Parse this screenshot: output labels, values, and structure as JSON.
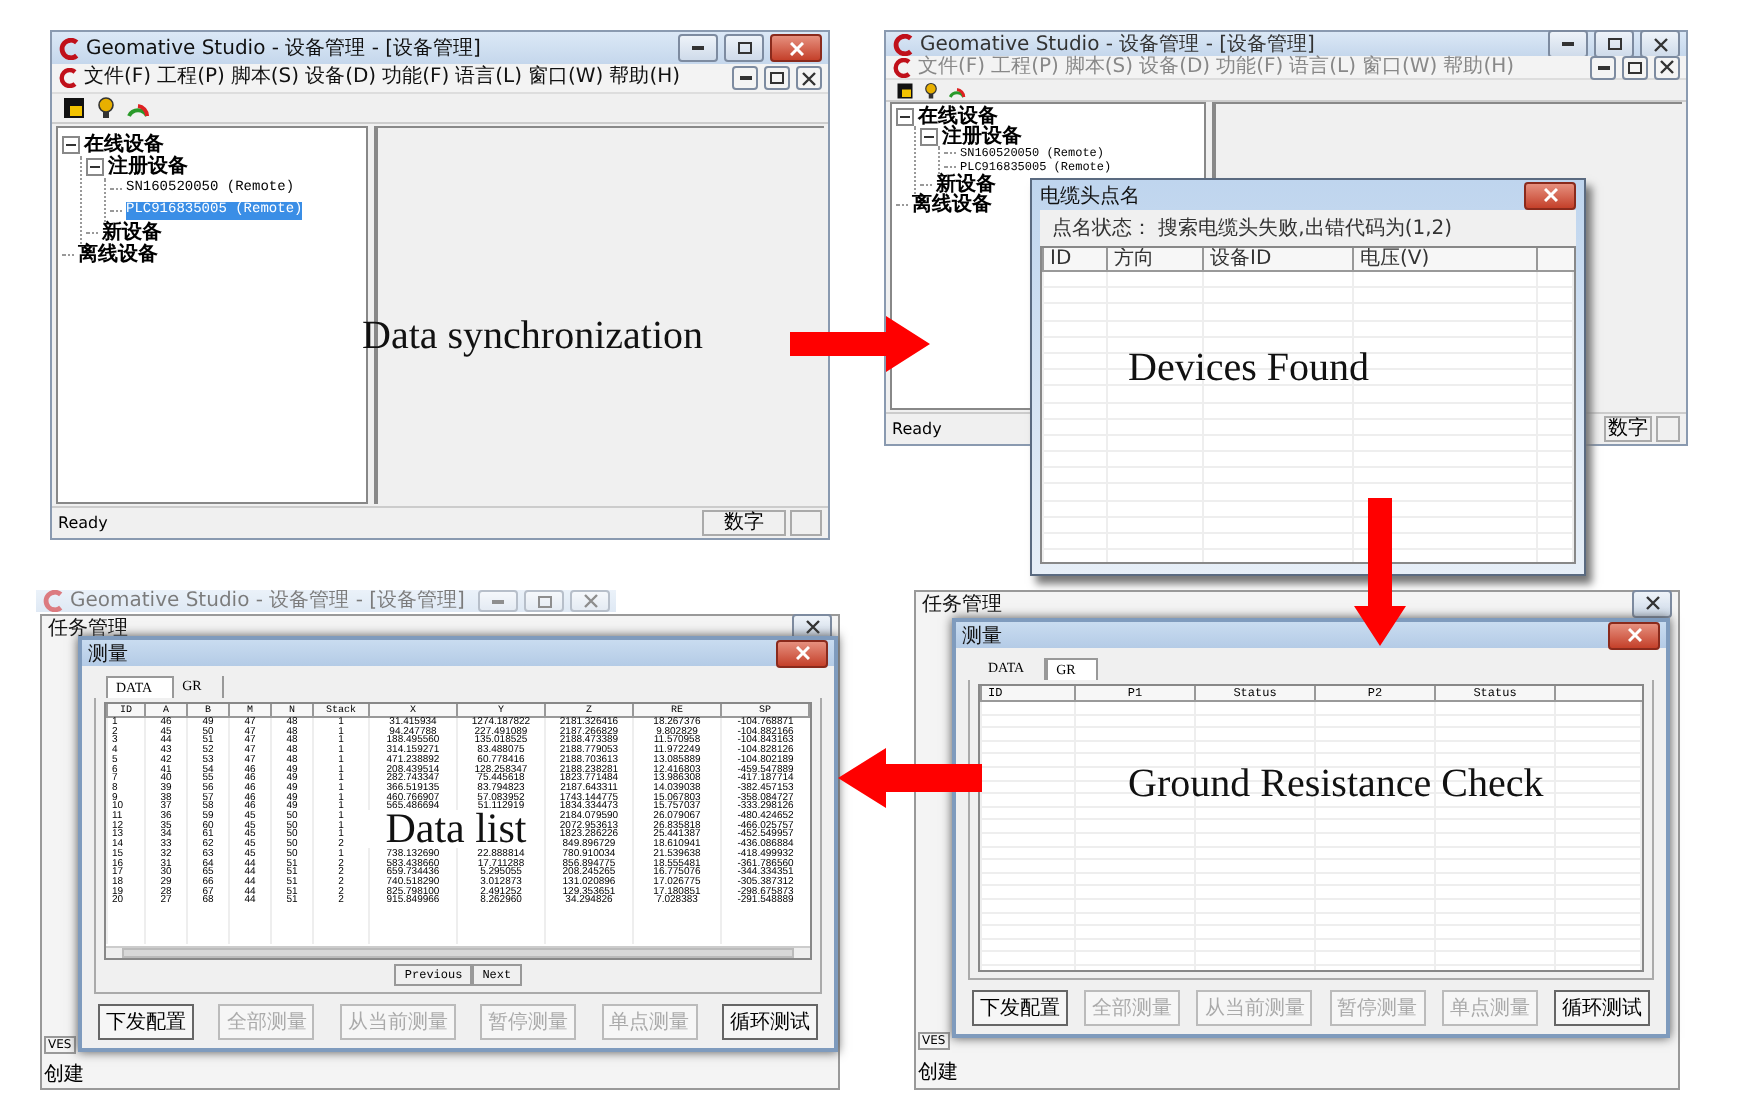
{
  "panels": [
    {
      "kind": "device_manager",
      "active": true,
      "window": {
        "title": "Geomative Studio - 设备管理 - [设备管理]"
      },
      "menu": [
        "文件(F)",
        "工程(P)",
        "脚本(S)",
        "设备(D)",
        "功能(F)",
        "语言(L)",
        "窗口(W)",
        "帮助(H)"
      ],
      "tree": [
        {
          "label": "在线设备",
          "expanded": true,
          "selected": false,
          "children": [
            {
              "label": "注册设备",
              "expanded": true,
              "selected": false,
              "children": [
                {
                  "label": "SN160520050 (Remote)",
                  "selected": false
                },
                {
                  "label": "PLC916835005 (Remote)",
                  "selected": true
                }
              ]
            },
            {
              "label": "新设备",
              "selected": false
            }
          ]
        },
        {
          "label": "离线设备",
          "selected": false
        }
      ],
      "status_bar": {
        "text": "Ready",
        "indicator": "数字"
      },
      "caption": "Data synchronization"
    },
    {
      "kind": "device_manager",
      "active": false,
      "window": {
        "title": "Geomative Studio - 设备管理 - [设备管理]"
      },
      "menu": [
        "文件(F)",
        "工程(P)",
        "脚本(S)",
        "设备(D)",
        "功能(F)",
        "语言(L)",
        "窗口(W)",
        "帮助(H)"
      ],
      "tree": [
        {
          "label": "在线设备",
          "expanded": true,
          "selected": false,
          "children": [
            {
              "label": "注册设备",
              "expanded": true,
              "selected": false,
              "children": [
                {
                  "label": "SN160520050 (Remote)",
                  "selected": false
                },
                {
                  "label": "PLC916835005 (Remote)",
                  "selected": false
                }
              ]
            },
            {
              "label": "新设备",
              "selected": false
            }
          ]
        },
        {
          "label": "离线设备",
          "selected": false
        }
      ],
      "status_bar": {
        "text": "Ready",
        "indicator": "数字"
      },
      "dialog": {
        "title": "电缆头点名",
        "status": "点名状态：  搜索电缆头失败,出错代码为(1,2)",
        "columns": [
          "ID",
          "方向",
          "设备ID",
          "电压(V)"
        ]
      },
      "caption": "Devices Found"
    },
    {
      "kind": "measurement",
      "back_window": {
        "title": "Geomative Studio - 设备管理 - [设备管理]"
      },
      "task_window": {
        "title": "任务管理",
        "tab": "VES",
        "label": "创建"
      },
      "dialog": {
        "title": "测量",
        "tabs": [
          {
            "label": "DATA",
            "selected": true
          },
          {
            "label": "GR",
            "selected": false
          }
        ],
        "columns": [
          "ID",
          "A",
          "B",
          "M",
          "N",
          "Stack",
          "X",
          "Y",
          "Z",
          "RE",
          "SP"
        ],
        "rows": [
          [
            "1",
            "46",
            "49",
            "47",
            "48",
            "1",
            "31.415934",
            "1274.187822",
            "2181.326416",
            "18.267376",
            "-104.768871"
          ],
          [
            "2",
            "45",
            "50",
            "47",
            "48",
            "1",
            "94.247788",
            "227.491089",
            "2187.266829",
            "9.802829",
            "-104.882166"
          ],
          [
            "3",
            "44",
            "51",
            "47",
            "48",
            "1",
            "188.495560",
            "135.018525",
            "2188.473389",
            "11.570958",
            "-104.843163"
          ],
          [
            "4",
            "43",
            "52",
            "47",
            "48",
            "1",
            "314.159271",
            "83.488075",
            "2188.779053",
            "11.972249",
            "-104.828126"
          ],
          [
            "5",
            "42",
            "53",
            "47",
            "48",
            "1",
            "471.238892",
            "60.778416",
            "2188.703613",
            "13.085889",
            "-104.802189"
          ],
          [
            "6",
            "41",
            "54",
            "46",
            "49",
            "1",
            "208.439514",
            "128.258347",
            "2188.238281",
            "12.416803",
            "-459.547889"
          ],
          [
            "7",
            "40",
            "55",
            "46",
            "49",
            "1",
            "282.743347",
            "75.445618",
            "1823.771484",
            "13.986308",
            "-417.187714"
          ],
          [
            "8",
            "39",
            "56",
            "46",
            "49",
            "1",
            "366.519135",
            "83.794823",
            "2187.643311",
            "14.039038",
            "-382.457153"
          ],
          [
            "9",
            "38",
            "57",
            "46",
            "49",
            "1",
            "460.766907",
            "57.083952",
            "1743.144775",
            "15.067803",
            "-358.084727"
          ],
          [
            "10",
            "37",
            "58",
            "46",
            "49",
            "1",
            "565.486694",
            "51.112919",
            "1834.334473",
            "15.757037",
            "-333.298126"
          ],
          [
            "11",
            "36",
            "59",
            "45",
            "50",
            "1",
            null,
            null,
            "2184.079590",
            "26.079067",
            "-480.424652"
          ],
          [
            "12",
            "35",
            "60",
            "45",
            "50",
            "1",
            null,
            null,
            "2072.953613",
            "26.835818",
            "-466.025757"
          ],
          [
            "13",
            "34",
            "61",
            "45",
            "50",
            "1",
            null,
            null,
            "1823.286226",
            "25.441387",
            "-452.549957"
          ],
          [
            "14",
            "33",
            "62",
            "45",
            "50",
            "2",
            null,
            null,
            "849.896729",
            "18.610941",
            "-436.086884"
          ],
          [
            "15",
            "32",
            "63",
            "45",
            "50",
            "1",
            "738.132690",
            "22.888814",
            "780.910034",
            "21.539638",
            "-418.499932"
          ],
          [
            "16",
            "31",
            "64",
            "44",
            "51",
            "2",
            "583.438660",
            "17.711288",
            "856.894775",
            "18.555481",
            "-361.786560"
          ],
          [
            "17",
            "30",
            "65",
            "44",
            "51",
            "2",
            "659.734436",
            "5.295055",
            "208.245265",
            "16.775076",
            "-344.334351"
          ],
          [
            "18",
            "29",
            "66",
            "44",
            "51",
            "2",
            "740.518290",
            "3.012873",
            "131.020896",
            "17.026775",
            "-305.387312"
          ],
          [
            "19",
            "28",
            "67",
            "44",
            "51",
            "2",
            "825.798100",
            "2.491252",
            "129.353651",
            "17.180851",
            "-298.675873"
          ],
          [
            "20",
            "27",
            "68",
            "44",
            "51",
            "2",
            "915.849966",
            "8.262960",
            "34.294826",
            "7.028383",
            "-291.548889"
          ]
        ],
        "pager": [
          "Previous",
          "Next"
        ],
        "buttons": [
          {
            "label": "下发配置",
            "disabled": false
          },
          {
            "label": "全部测量",
            "disabled": true
          },
          {
            "label": "从当前测量",
            "disabled": true
          },
          {
            "label": "暂停测量",
            "disabled": true
          },
          {
            "label": "单点测量",
            "disabled": true
          },
          {
            "label": "循环测试",
            "disabled": false
          }
        ]
      },
      "caption": "Data list"
    },
    {
      "kind": "measurement",
      "task_window": {
        "title": "任务管理",
        "tab": "VES",
        "label": "创建"
      },
      "dialog": {
        "title": "测量",
        "tabs": [
          {
            "label": "DATA",
            "selected": false
          },
          {
            "label": "GR",
            "selected": true
          }
        ],
        "columns": [
          "ID",
          "P1",
          "Status",
          "P2",
          "Status"
        ],
        "buttons": [
          {
            "label": "下发配置",
            "disabled": false
          },
          {
            "label": "全部测量",
            "disabled": true
          },
          {
            "label": "从当前测量",
            "disabled": true
          },
          {
            "label": "暂停测量",
            "disabled": true
          },
          {
            "label": "单点测量",
            "disabled": true
          },
          {
            "label": "循环测试",
            "disabled": false
          }
        ]
      },
      "caption": "Ground Resistance Check"
    }
  ]
}
